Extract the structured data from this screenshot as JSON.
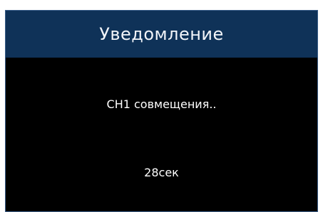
{
  "dialog": {
    "title": "Уведомление",
    "message": "CH1 совмещения..",
    "countdown": "28сек"
  },
  "colors": {
    "titlebar_bg": "#0f3258",
    "dialog_bg": "#000000",
    "text": "#ffffff"
  }
}
